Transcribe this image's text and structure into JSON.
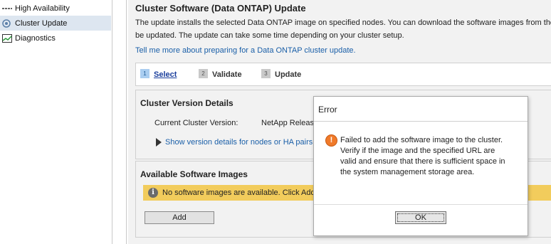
{
  "sidebar": {
    "items": [
      {
        "label": "High Availability",
        "icon": "high-availability-icon"
      },
      {
        "label": "Cluster Update",
        "icon": "cluster-update-icon",
        "selected": true
      },
      {
        "label": "Diagnostics",
        "icon": "diagnostics-icon"
      }
    ]
  },
  "main": {
    "title": "Cluster Software (Data ONTAP) Update",
    "description": "The update installs the selected Data ONTAP image on specified nodes. You can download the software images from the be updated. The update can take some time depending on your cluster setup.",
    "help_link": "Tell me more about preparing for a Data ONTAP cluster update.",
    "steps": [
      {
        "num": "1",
        "label": "Select",
        "active": true
      },
      {
        "num": "2",
        "label": "Validate",
        "active": false
      },
      {
        "num": "3",
        "label": "Update",
        "active": false
      }
    ],
    "version_panel": {
      "title": "Cluster Version Details",
      "current_label": "Current Cluster Version:",
      "current_value": "NetApp Release",
      "show_details": "Show version details for nodes or HA pairs"
    },
    "images_panel": {
      "title": "Available Software Images",
      "info_text": "No software images are available. Click Add",
      "add_label": "Add"
    }
  },
  "dialog": {
    "title": "Error",
    "message": "Failed to add the software image to the cluster. Verify if the image and the specified URL are valid and ensure that there is sufficient space in the system management storage area.",
    "ok_label": "OK"
  },
  "colors": {
    "selected_nav": "#dde6f0",
    "link": "#1a5fa8",
    "info_banner": "#f2cc5c",
    "error_icon": "#f07a2a"
  }
}
